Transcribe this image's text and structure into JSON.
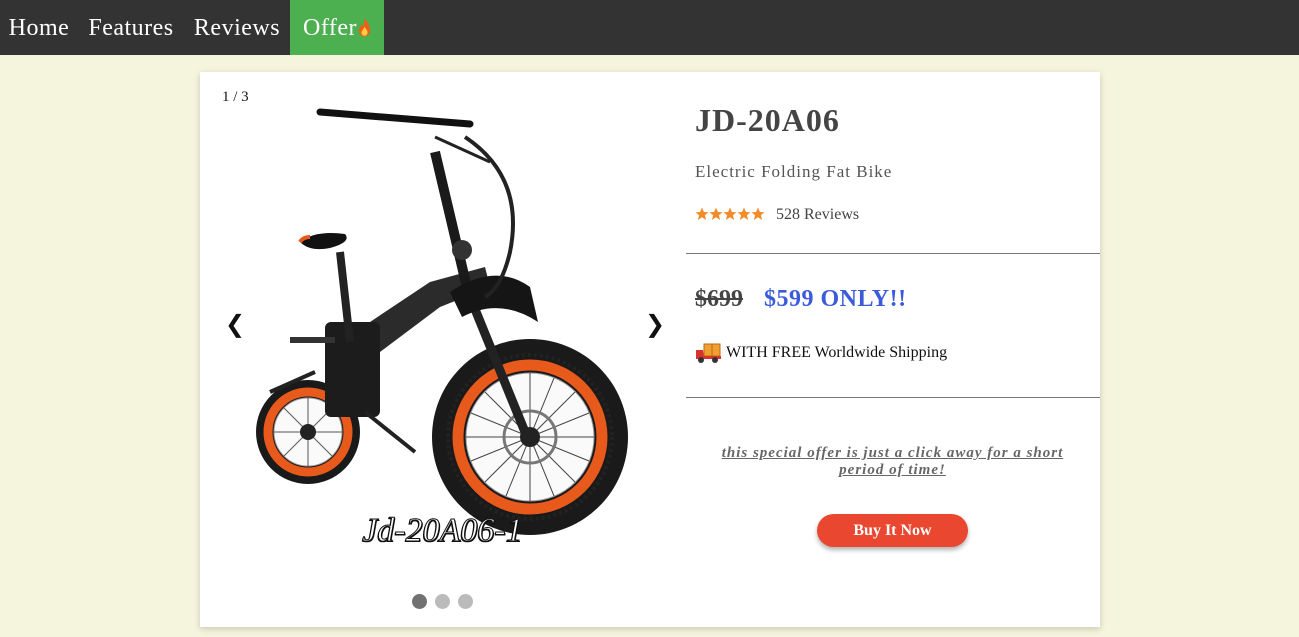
{
  "nav": {
    "items": [
      {
        "label": "Home"
      },
      {
        "label": "Features"
      },
      {
        "label": "Reviews"
      },
      {
        "label": "Offer"
      }
    ],
    "active_color": "#4caf50",
    "bg_color": "#333333"
  },
  "slider": {
    "counter": "1 / 3",
    "caption": "Jd-20A06-1",
    "prev_icon": "chevron-left-icon",
    "next_icon": "chevron-right-icon",
    "slide_count": 3,
    "active_slide": 1
  },
  "product": {
    "title": "JD-20A06",
    "subtitle": "Electric Folding Fat Bike",
    "rating_stars": 5,
    "reviews": "528 Reviews",
    "old_price": "$699",
    "new_price": "$599 ONLY!!",
    "shipping": "WITH FREE Worldwide Shipping",
    "special_offer": "this special offer is just a click away for a short period of time!",
    "buy_label": "Buy It Now"
  },
  "colors": {
    "page_bg": "#f5f4dc",
    "price_blue": "#3b5bdb",
    "button": "#e9472f",
    "star": "#f28c28"
  }
}
